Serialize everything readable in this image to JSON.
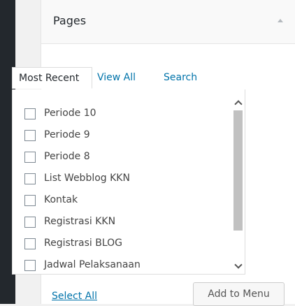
{
  "panel": {
    "title": "Pages",
    "collapse_icon": "triangle-up-icon"
  },
  "tabs": [
    {
      "label": "Most Recent",
      "active": true
    },
    {
      "label": "View All",
      "active": false
    },
    {
      "label": "Search",
      "active": false
    }
  ],
  "pages": [
    {
      "label": "Periode 10",
      "checked": false
    },
    {
      "label": "Periode 9",
      "checked": false
    },
    {
      "label": "Periode 8",
      "checked": false
    },
    {
      "label": "List Webblog KKN",
      "checked": false
    },
    {
      "label": "Kontak",
      "checked": false
    },
    {
      "label": "Registrasi KKN",
      "checked": false
    },
    {
      "label": "Registrasi BLOG",
      "checked": false
    },
    {
      "label": "Jadwal Pelaksanaan",
      "checked": false
    }
  ],
  "footer": {
    "select_all": "Select All",
    "add_button": "Add to Menu"
  },
  "colors": {
    "link": "#0073aa",
    "admin_bar": "#23282d",
    "header_bg": "#f9f9f9",
    "border": "#dddddd"
  }
}
